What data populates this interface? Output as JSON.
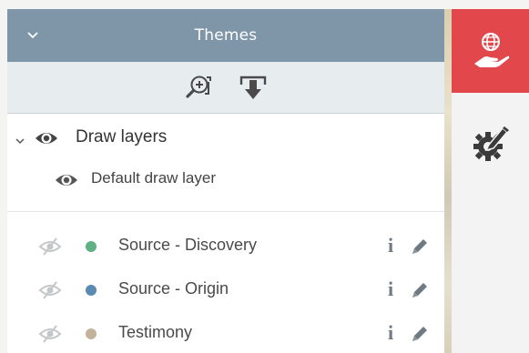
{
  "panel": {
    "title": "Themes",
    "toolbar": {
      "icons": [
        "zoom-to-layer-icon",
        "download-icon"
      ]
    }
  },
  "draw_layers": {
    "label": "Draw layers",
    "children": [
      {
        "label": "Default draw layer"
      }
    ]
  },
  "layers": [
    {
      "label": "Source - Discovery",
      "color": "#5fb184"
    },
    {
      "label": "Source - Origin",
      "color": "#5b8bb3"
    },
    {
      "label": "Testimony",
      "color": "#c2b39a"
    }
  ],
  "rail": {
    "active_color": "#e2474c",
    "buttons": [
      "globe-hand-icon",
      "settings-pencil-icon"
    ]
  }
}
